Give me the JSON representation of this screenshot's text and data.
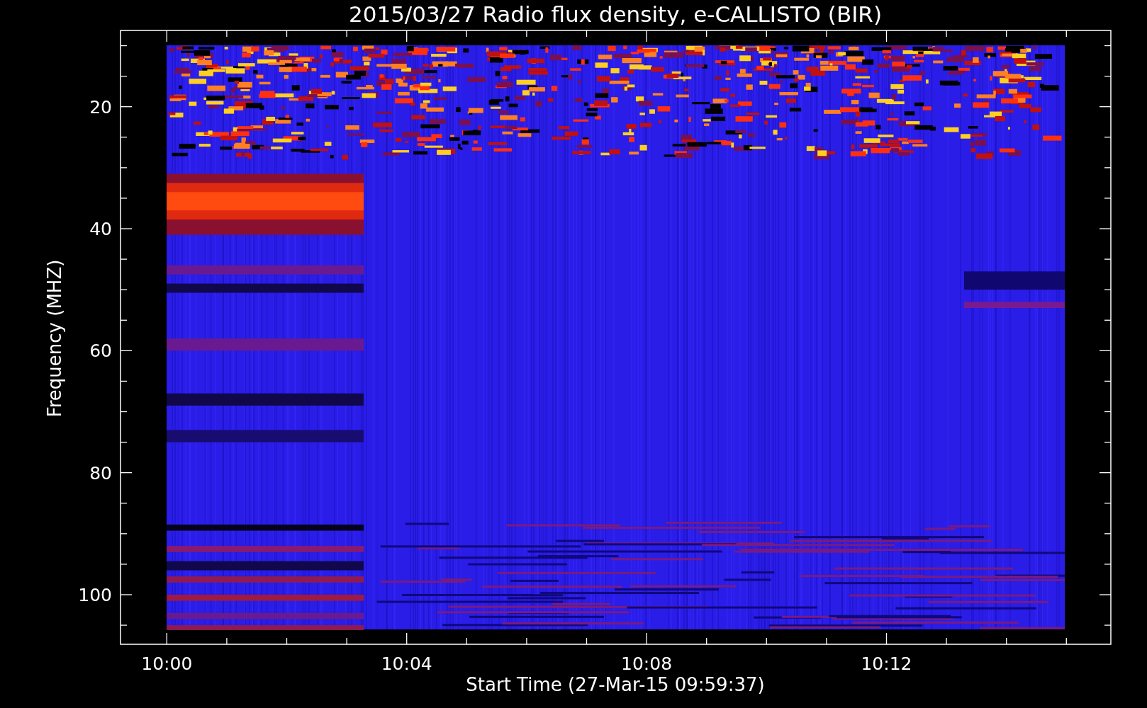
{
  "title": "2015/03/27  Radio flux density, e-CALLISTO (BIR)",
  "plot": {
    "ylabel": "Frequency (MHZ)",
    "xlabel": "Start Time (27-Mar-15 09:59:37)",
    "yticks": [
      "20",
      "40",
      "60",
      "80",
      "100"
    ],
    "xticks": [
      "10:00",
      "10:04",
      "10:08",
      "10:12"
    ]
  }
}
